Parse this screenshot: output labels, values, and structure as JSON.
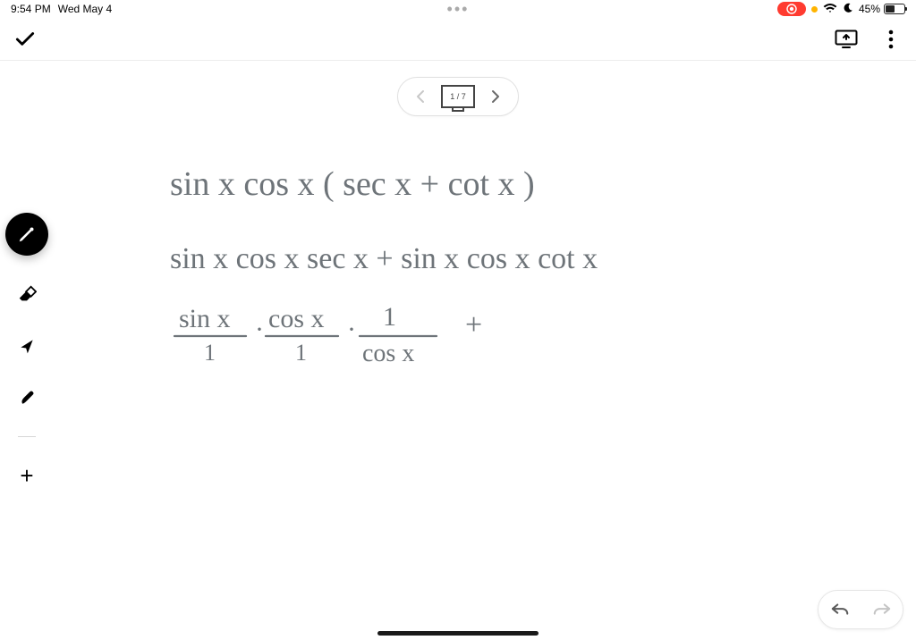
{
  "status_bar": {
    "time": "9:54 PM",
    "date": "Wed May 4",
    "recording": true,
    "battery_pct": "45%",
    "wifi_icon": "wifi-icon",
    "dnd_icon": "moon-icon"
  },
  "app_bar": {
    "done_icon": "checkmark-icon",
    "cast_icon": "cast-icon",
    "menu_icon": "more-vert-icon"
  },
  "page_nav": {
    "prev_enabled": false,
    "next_enabled": true,
    "page_label": "1 / 7"
  },
  "tool_rail": {
    "pen_active": true,
    "tools": [
      "pen-icon",
      "eraser-icon",
      "pointer-icon",
      "marker-icon"
    ],
    "add_label": "+"
  },
  "undo_redo": {
    "undo_enabled": true,
    "redo_enabled": false
  },
  "handwriting": {
    "color": "#6e7479",
    "line1": "sin x cos x ( sec x + cot x )",
    "line2": "sin x cos x sec x  +  sin x cos x cot x",
    "line3_frac1_num": "sin x",
    "line3_frac1_den": "1",
    "line3_dot1": "·",
    "line3_frac2_num": "cos x",
    "line3_frac2_den": "1",
    "line3_dot2": "·",
    "line3_frac3_num": "1",
    "line3_frac3_den": "cos x",
    "line3_plus": "+"
  }
}
